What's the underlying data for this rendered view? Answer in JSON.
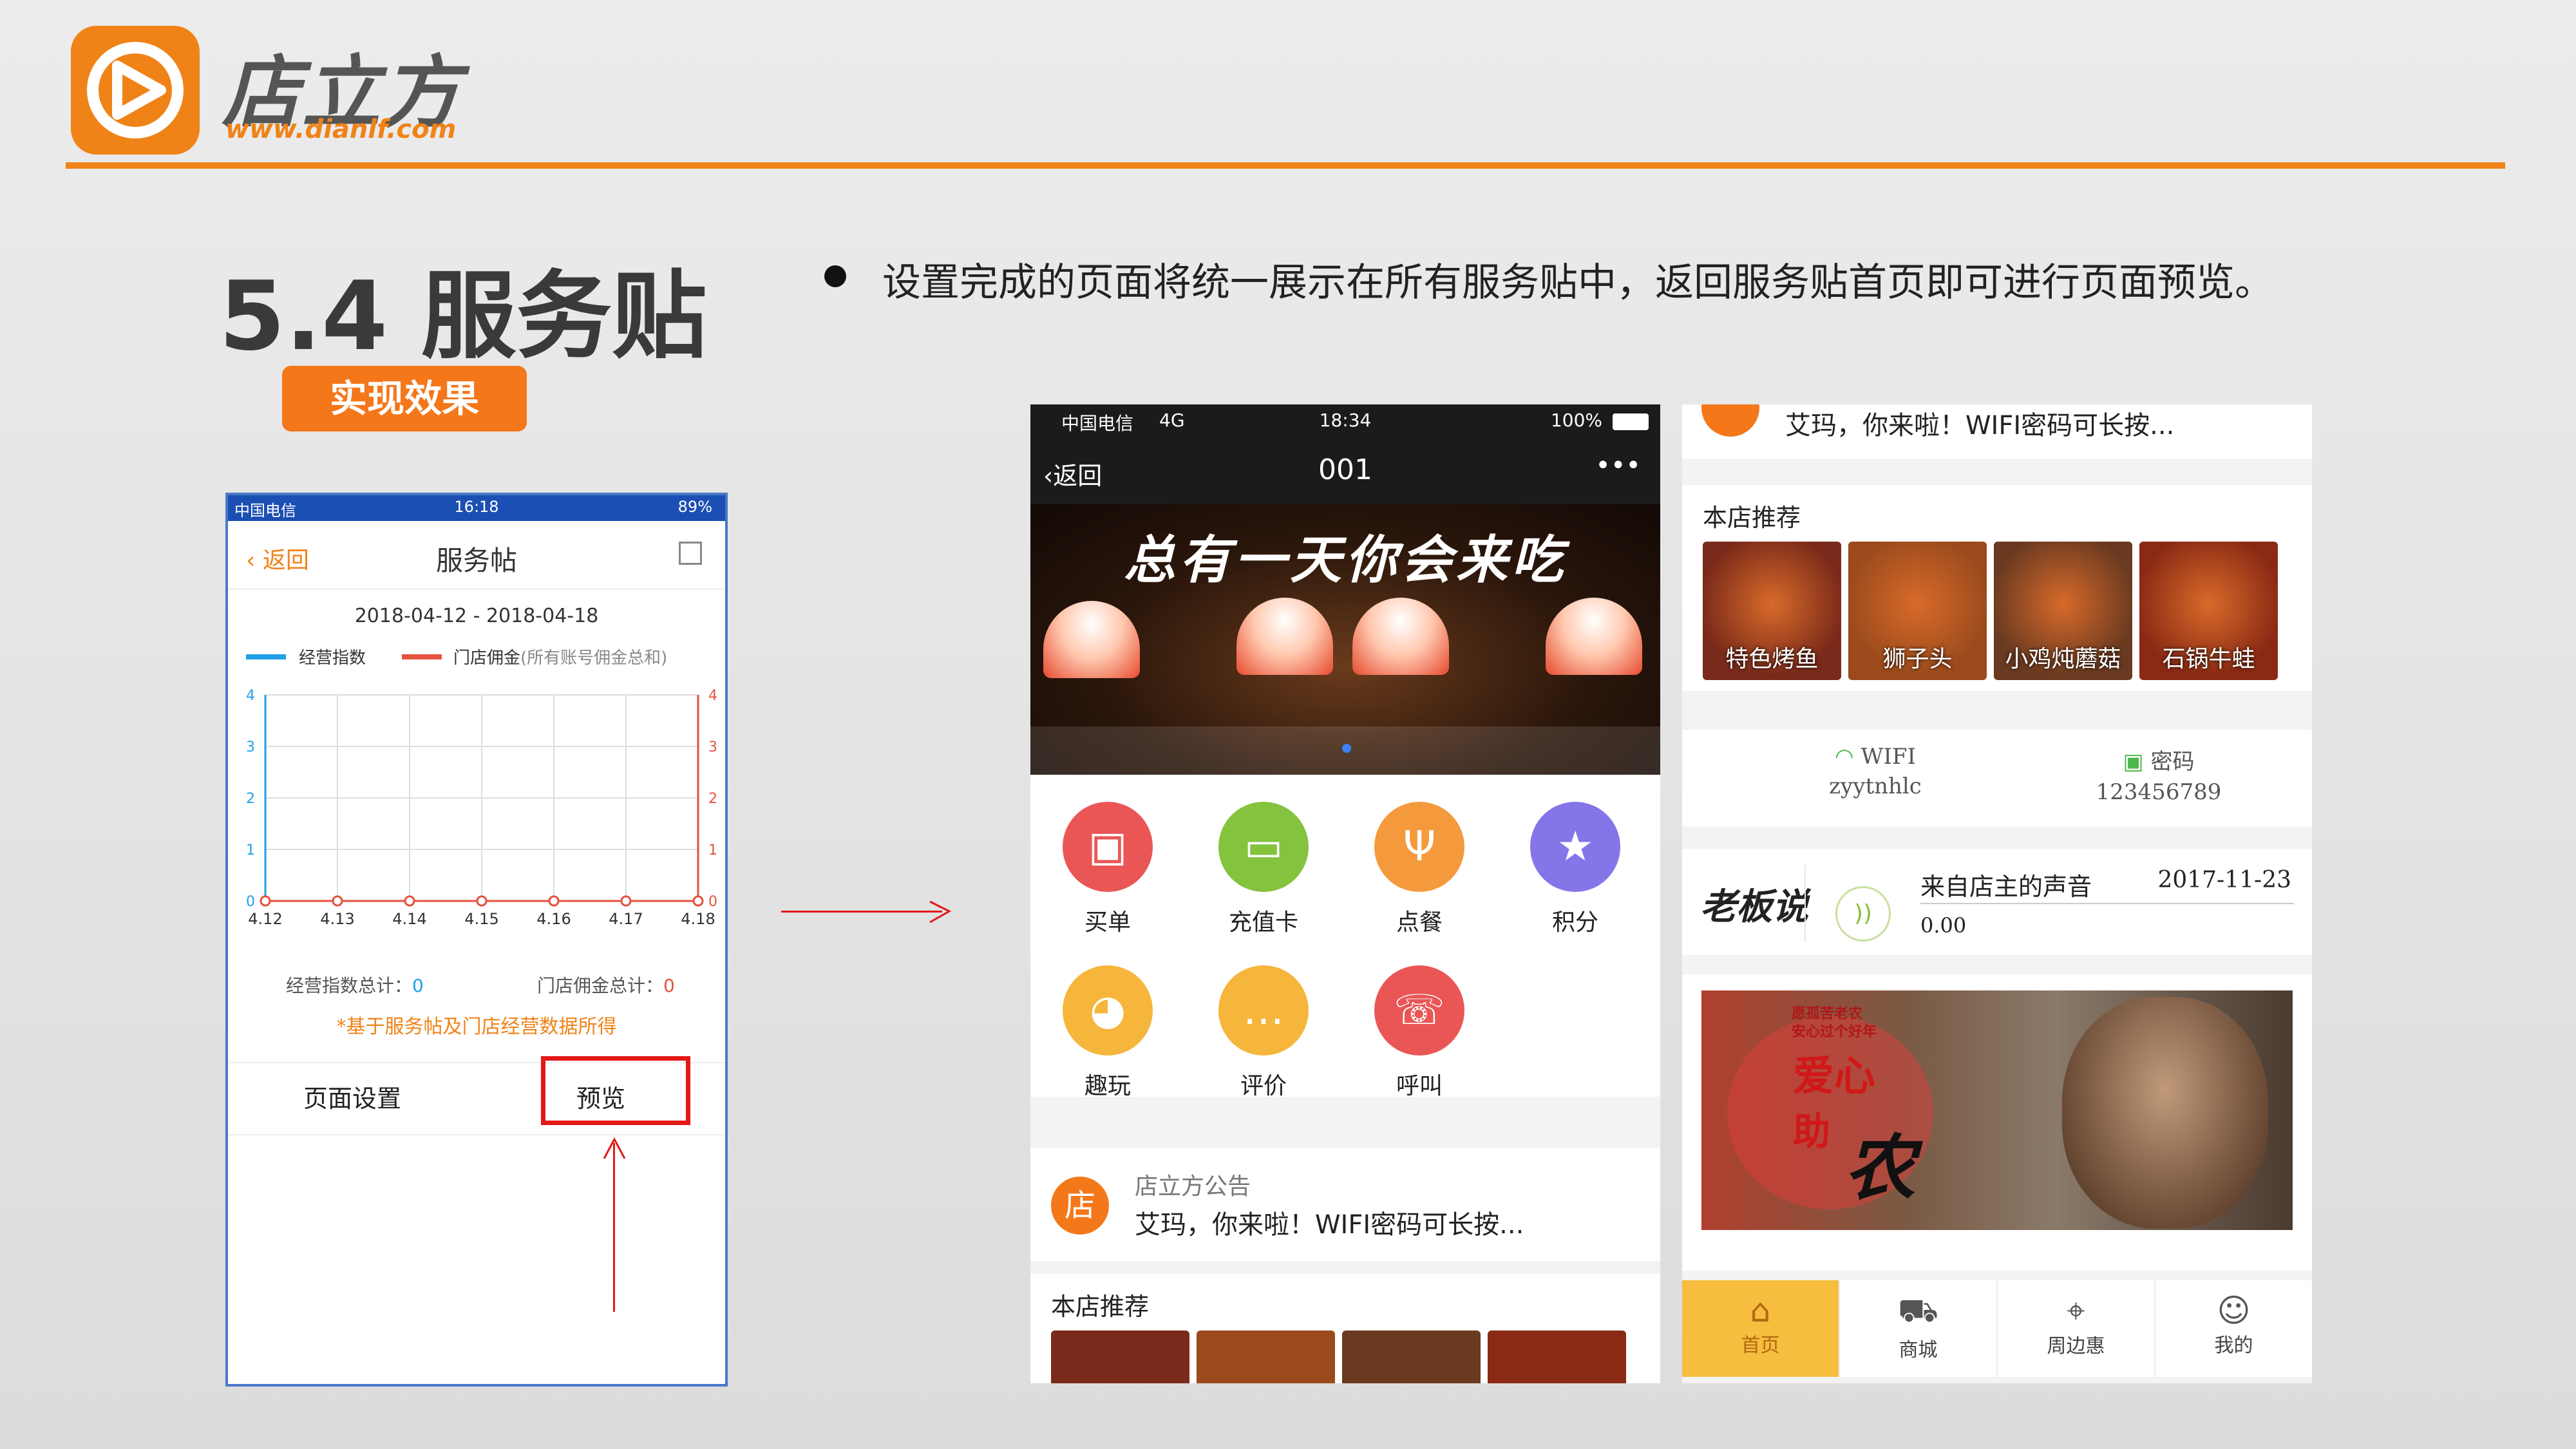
{
  "brand": {
    "name_cn": "店立方",
    "url": "www.dianlf.com",
    "accent": "#f08317"
  },
  "slide": {
    "section_title": "5.4 服务贴",
    "badge": "实现效果",
    "bullet": "设置完成的页面将统一展示在所有服务贴中，返回服务贴首页即可进行页面预览。"
  },
  "phone1": {
    "status": {
      "carrier": "中国电信",
      "time": "16:18",
      "battery": "89%"
    },
    "nav": {
      "back": "返回",
      "title": "服务帖"
    },
    "date_range": "2018-04-12 - 2018-04-18",
    "legend": [
      {
        "name": "经营指数",
        "color": "#1fa0e6"
      },
      {
        "name": "门店佣金",
        "suffix": "(所有账号佣金总和)",
        "color": "#e5523e"
      }
    ],
    "totals": {
      "index_label": "经营指数总计：",
      "index_value": "0",
      "commission_label": "门店佣金总计：",
      "commission_value": "0"
    },
    "note": "*基于服务帖及门店经营数据所得",
    "footer": {
      "settings": "页面设置",
      "preview": "预览"
    }
  },
  "chart_data": {
    "type": "line",
    "categories": [
      "4.12",
      "4.13",
      "4.14",
      "4.15",
      "4.16",
      "4.17",
      "4.18"
    ],
    "series": [
      {
        "name": "经营指数",
        "values": [
          0,
          0,
          0,
          0,
          0,
          0,
          0
        ],
        "color": "#1fa0e6"
      },
      {
        "name": "门店佣金",
        "values": [
          0,
          0,
          0,
          0,
          0,
          0,
          0
        ],
        "color": "#e5523e"
      }
    ],
    "ylim": [
      0,
      4
    ],
    "y_ticks_left": [
      "0",
      "1",
      "2",
      "3",
      "4"
    ],
    "y_ticks_right": [
      "0",
      "1",
      "2",
      "3",
      "4"
    ],
    "grid": true
  },
  "phone2": {
    "status": {
      "carrier": "中国电信",
      "network": "4G",
      "time": "18:34",
      "battery": "100%"
    },
    "nav": {
      "back": "返回",
      "title": "001",
      "more": "•••"
    },
    "banner_text": "总有一天你会来吃",
    "icons": [
      {
        "label": "买单",
        "color": "#ea5656",
        "glyph": "▣"
      },
      {
        "label": "充值卡",
        "color": "#84c33e",
        "glyph": "▭"
      },
      {
        "label": "点餐",
        "color": "#f59a3c",
        "glyph": "Ψ"
      },
      {
        "label": "积分",
        "color": "#8476e8",
        "glyph": "★"
      },
      {
        "label": "趣玩",
        "color": "#f6b53b",
        "glyph": "◕"
      },
      {
        "label": "评价",
        "color": "#f6b53b",
        "glyph": "…"
      },
      {
        "label": "呼叫",
        "color": "#ea5656",
        "glyph": "☏"
      }
    ],
    "notice": {
      "badge": "店",
      "title": "店立方公告",
      "text": "艾玛，你来啦！WIFI密码可长按..."
    },
    "recommend_title": "本店推荐"
  },
  "phone3": {
    "notice_text": "艾玛，你来啦！WIFI密码可长按...",
    "recommend_title": "本店推荐",
    "foods": [
      {
        "name": "特色烤鱼",
        "color": "#7a2a1a"
      },
      {
        "name": "狮子头",
        "color": "#9a4a1c"
      },
      {
        "name": "小鸡炖蘑菇",
        "color": "#6a3a20"
      },
      {
        "name": "石锅牛蛙",
        "color": "#8a2a14"
      }
    ],
    "wifi": {
      "label": "WIFI",
      "ssid": "zyytnhlc"
    },
    "password": {
      "label": "密码",
      "value": "123456789"
    },
    "owner_voice": {
      "logo": "老板说",
      "title": "来自店主的声音",
      "date": "2017-11-23",
      "duration": "0.00"
    },
    "ad": {
      "line1": "愿孤苦老农",
      "line2": "安心过个好年",
      "big1": "爱心",
      "big2": "助",
      "big3": "农"
    },
    "tabs": [
      {
        "label": "首页",
        "icon": "home-icon",
        "active": true
      },
      {
        "label": "商城",
        "icon": "cart-icon",
        "active": false
      },
      {
        "label": "周边惠",
        "icon": "location-icon",
        "active": false
      },
      {
        "label": "我的",
        "icon": "user-icon",
        "active": false
      }
    ]
  }
}
